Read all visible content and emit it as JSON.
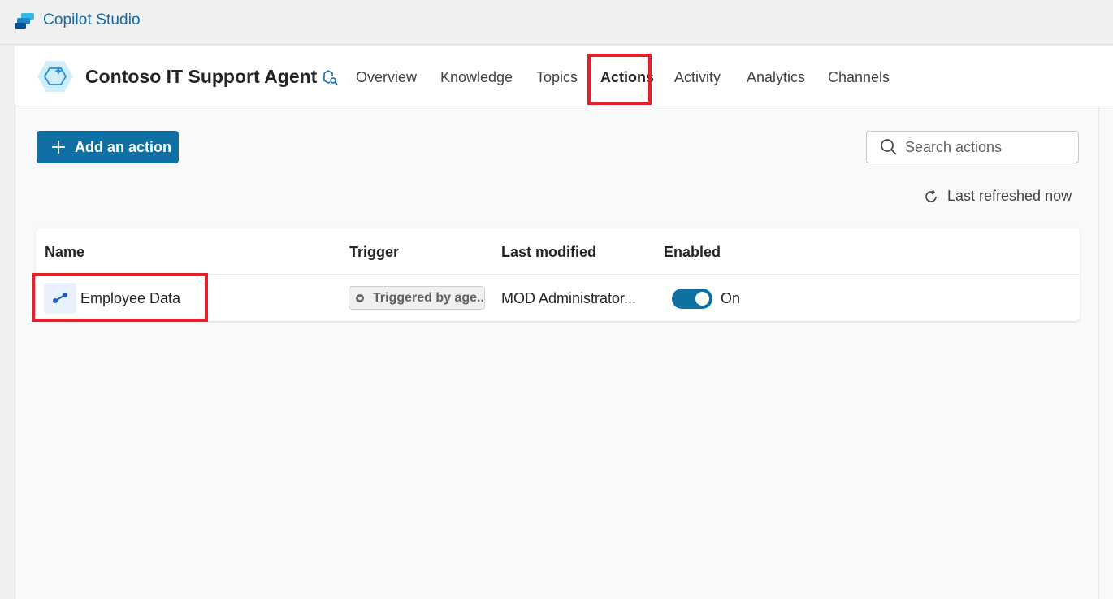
{
  "app": {
    "title": "Copilot Studio",
    "logo_icon": "copilot-studio-logo"
  },
  "agent": {
    "name": "Contoso IT Support Agent",
    "edit_icon": "agent-settings-icon"
  },
  "tabs": [
    {
      "label": "Overview",
      "active": false
    },
    {
      "label": "Knowledge",
      "active": false
    },
    {
      "label": "Topics",
      "active": false
    },
    {
      "label": "Actions",
      "active": true
    },
    {
      "label": "Activity",
      "active": false
    },
    {
      "label": "Analytics",
      "active": false
    },
    {
      "label": "Channels",
      "active": false
    }
  ],
  "toolbar": {
    "add_label": "Add an action",
    "search_placeholder": "Search actions",
    "refresh_text": "Last refreshed now"
  },
  "table": {
    "columns": [
      "Name",
      "Trigger",
      "Last modified",
      "Enabled"
    ],
    "rows": [
      {
        "name": "Employee Data",
        "trigger": "Triggered by age...",
        "modified_by": "MOD Administrator...",
        "enabled": true,
        "enabled_label": "On"
      }
    ]
  },
  "colors": {
    "accent": "#1070a4",
    "highlight": "#e3202a",
    "brand_text": "#116aa6"
  }
}
